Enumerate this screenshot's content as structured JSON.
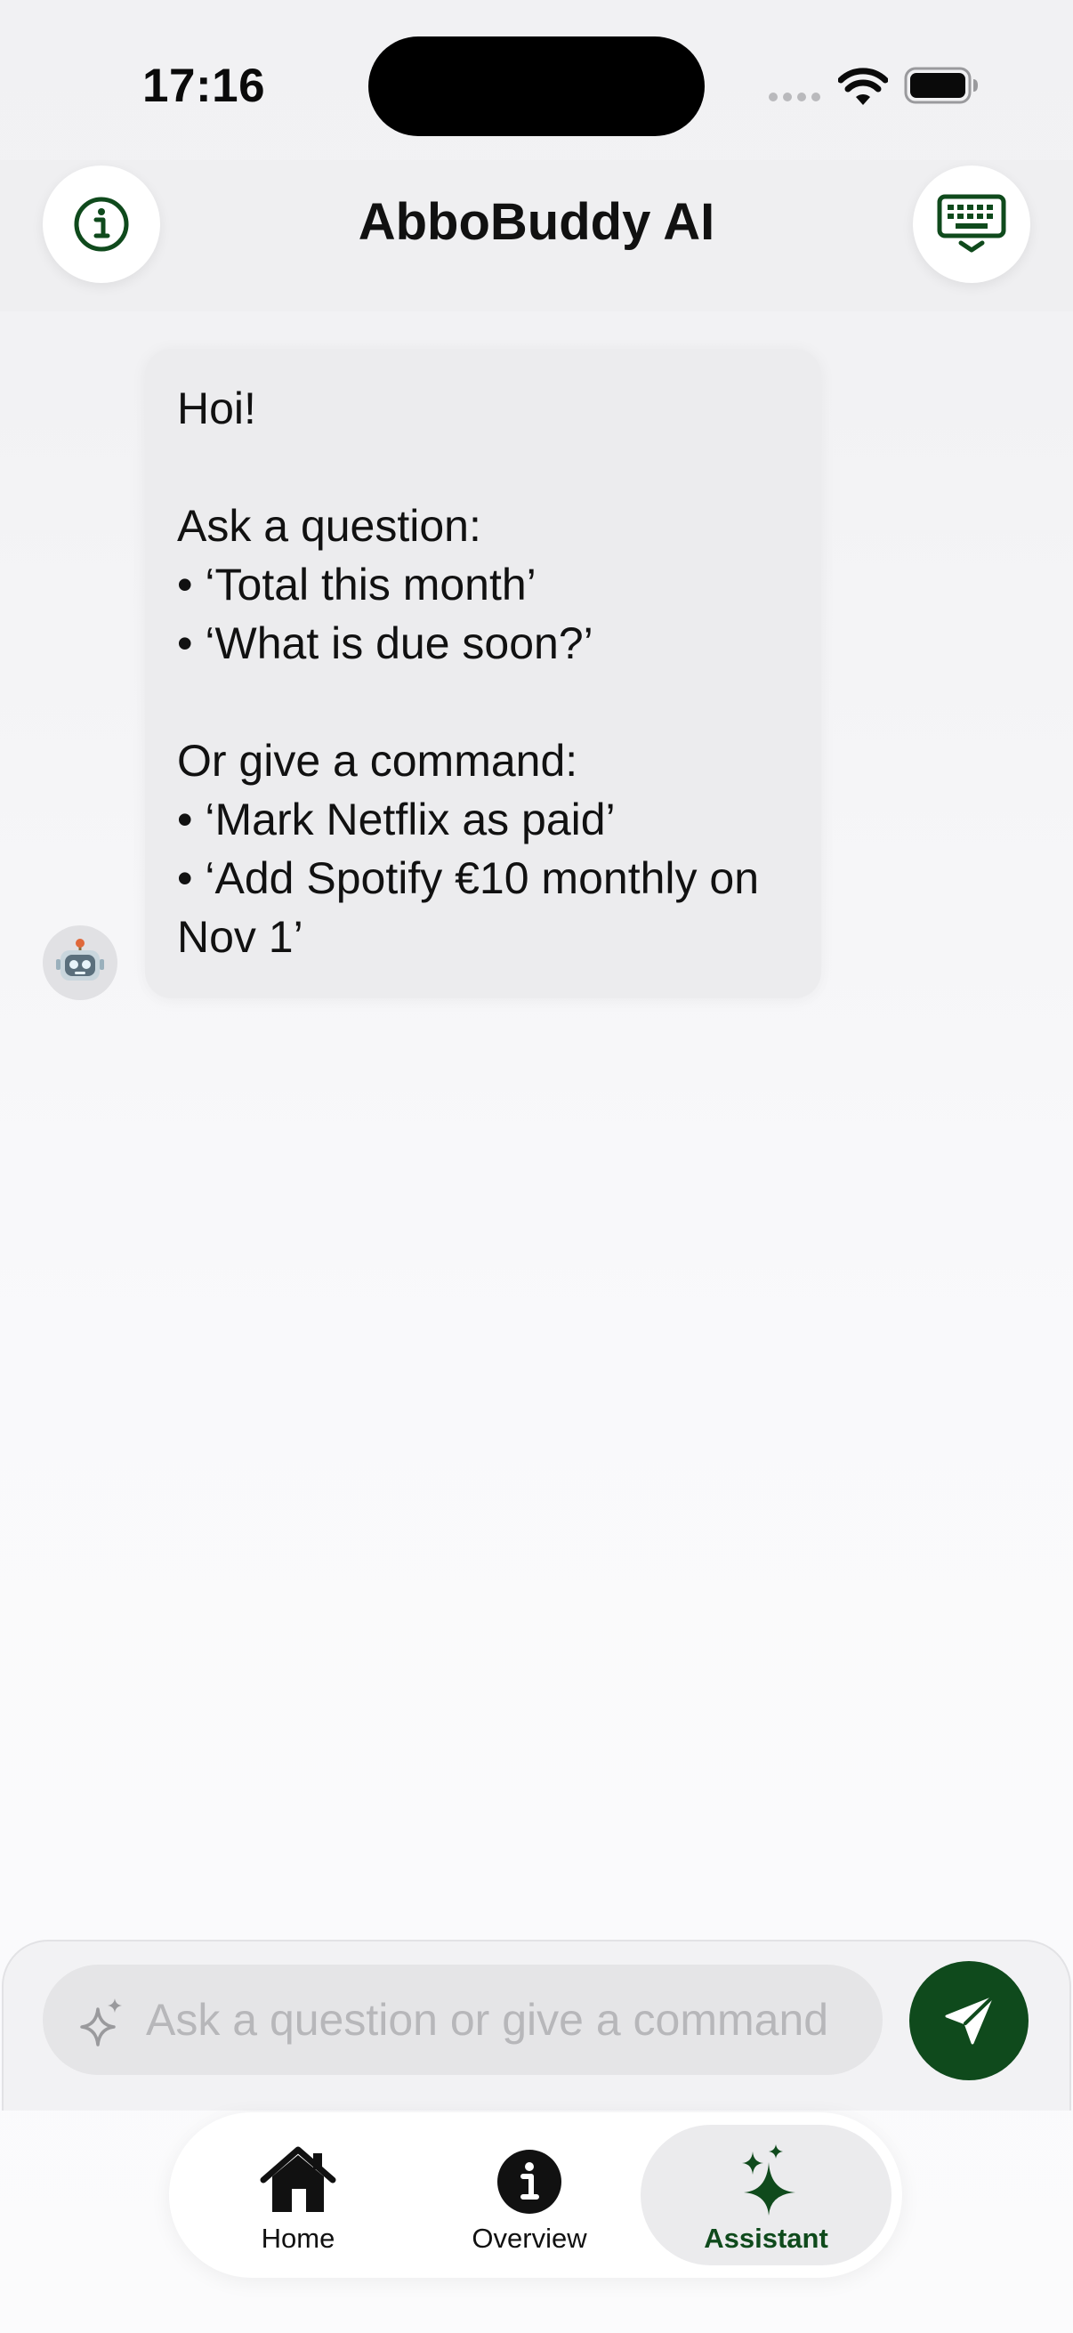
{
  "status_bar": {
    "time": "17:16"
  },
  "header": {
    "title": "AbboBuddy AI",
    "info_icon": "info-circle-icon",
    "keyboard_icon": "keyboard-icon"
  },
  "chat": {
    "bot_avatar": "🤖",
    "message": {
      "greeting": "Hoi!",
      "question_heading": "Ask a question:",
      "question_examples": [
        "• ‘Total this month’",
        "• ‘What is due soon?’"
      ],
      "command_heading": "Or give a command:",
      "command_examples": [
        "• ‘Mark Netflix as paid’",
        "• ‘Add Spotify €10 monthly on Nov 1’"
      ]
    }
  },
  "composer": {
    "placeholder": "Ask a question or give a command",
    "value": "",
    "send_icon": "send-icon"
  },
  "tabbar": {
    "items": [
      {
        "label": "Home",
        "icon": "home-icon",
        "active": false
      },
      {
        "label": "Overview",
        "icon": "info-icon",
        "active": false
      },
      {
        "label": "Assistant",
        "icon": "sparkles-icon",
        "active": true
      }
    ]
  },
  "colors": {
    "accent": "#0f4a1c",
    "bubble": "#ececee",
    "background": "#f2f2f4"
  }
}
